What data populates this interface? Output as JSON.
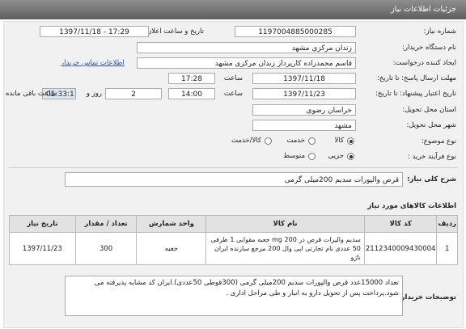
{
  "header": {
    "title": "جزئیات اطلاعات نیاز"
  },
  "form": {
    "need_number": {
      "label": "شماره نیاز:",
      "value": "1197004885000285"
    },
    "announce": {
      "label": "تاریخ و ساعت اعلان عمومی:",
      "value": "1397/11/18 - 17:29"
    },
    "buyer_org": {
      "label": "نام دستگاه خریدار:",
      "value": "زندان مرکزی مشهد"
    },
    "requester": {
      "label": "ایجاد کننده درخواست:",
      "value": "قاسم محمدزاده کارپرداز زندان مرکزی مشهد"
    },
    "contact_link": "اطلاعات تماس خریدار",
    "send_deadline": {
      "label": "مهلت ارسال پاسخ: تا تاریخ:",
      "date": "1397/11/18",
      "time_label": "ساعت",
      "time": "17:28"
    },
    "price_deadline": {
      "label": "تاریخ اعتبار پیشنهاد: تا تاریخ:",
      "date": "1397/11/23",
      "time_label": "ساعت",
      "time": "14:00",
      "days": "2",
      "days_label": "روز و",
      "remaining": "05:33:11",
      "remaining_label": "ساعت باقی مانده"
    },
    "province": {
      "label": "استان محل تحویل:",
      "value": "خراسان رضوی"
    },
    "city": {
      "label": "شهر محل تحویل:",
      "value": "مشهد"
    },
    "category": {
      "label": "نوع موضوع:",
      "options": [
        "کالا",
        "خدمت",
        "کالا/خدمت"
      ],
      "selected": "کالا"
    },
    "process": {
      "label": "نوع فرآیند خرید :",
      "options": [
        "جزیی",
        "متوسط"
      ],
      "selected": "جزیی"
    }
  },
  "summary": {
    "label": "شرح کلی نیاز:",
    "value": "قرص والپورات سدیم 200میلی گرمی"
  },
  "goods": {
    "title": "اطلاعات کالاهای مورد نیاز",
    "columns": [
      "ردیف",
      "کد کالا",
      "نام کالا",
      "واحد شمارش",
      "تعداد / مقدار",
      "تاریخ نیاز"
    ],
    "rows": [
      {
        "row": "1",
        "code": "2112340009430004",
        "name": "سدیم والپرات قرص در mg 200 جعبه مقوایی 1 ظرفی 50 عددی نام تجارتی اپی وال 200 مرجع سازنده ایران ناژو",
        "unit": "جعبه",
        "qty": "300",
        "date": "1397/11/23"
      }
    ]
  },
  "notes": {
    "label": "توضیحات خریدار:",
    "value": "تعداد 15000عدد قرص والپورات سدیم 200میلی گرمی (300قوطی 50عددی).ایران کد مشابه پذیرفته می شود.پرداخت پس از تحویل دارو به انبار و طی مراحل اداری ."
  }
}
